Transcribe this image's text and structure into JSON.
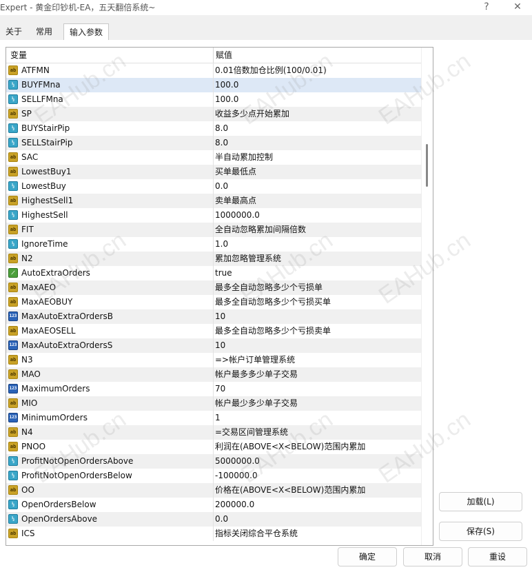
{
  "window": {
    "title": "Expert - 黄金印钞机-EA，五天翻倍系统~",
    "help_label": "?",
    "close_label": "✕"
  },
  "tabs": [
    {
      "label": "关于"
    },
    {
      "label": "常用"
    },
    {
      "label": "输入参数"
    }
  ],
  "table": {
    "header_variable": "变量",
    "header_value": "赋值",
    "rows": [
      {
        "type": "ab",
        "name": "ATFMN",
        "value": "0.01倍数加仓比例(100/0.01)"
      },
      {
        "type": "dbl",
        "name": "BUYFMna",
        "value": "100.0"
      },
      {
        "type": "dbl",
        "name": "SELLFMna",
        "value": "100.0"
      },
      {
        "type": "ab",
        "name": "SP",
        "value": "收益多少点开始累加"
      },
      {
        "type": "dbl",
        "name": "BUYStairPip",
        "value": "8.0"
      },
      {
        "type": "dbl",
        "name": "SELLStairPip",
        "value": "8.0"
      },
      {
        "type": "ab",
        "name": "SAC",
        "value": "半自动累加控制"
      },
      {
        "type": "ab",
        "name": "LowestBuy1",
        "value": "买单最低点"
      },
      {
        "type": "dbl",
        "name": "LowestBuy",
        "value": "0.0"
      },
      {
        "type": "ab",
        "name": "HighestSell1",
        "value": "卖单最高点"
      },
      {
        "type": "dbl",
        "name": "HighestSell",
        "value": "1000000.0"
      },
      {
        "type": "ab",
        "name": "FIT",
        "value": "全自动忽略累加间隔倍数"
      },
      {
        "type": "dbl",
        "name": "IgnoreTime",
        "value": "1.0"
      },
      {
        "type": "ab",
        "name": "N2",
        "value": "累加忽略管理系统"
      },
      {
        "type": "bool",
        "name": "AutoExtraOrders",
        "value": "true"
      },
      {
        "type": "ab",
        "name": "MaxAEO",
        "value": "最多全自动忽略多少个亏损单"
      },
      {
        "type": "ab",
        "name": "MaxAEOBUY",
        "value": "最多全自动忽略多少个亏损买单"
      },
      {
        "type": "int",
        "name": "MaxAutoExtraOrdersB",
        "value": "10"
      },
      {
        "type": "ab",
        "name": "MaxAEOSELL",
        "value": "最多全自动忽略多少个亏损卖单"
      },
      {
        "type": "int",
        "name": "MaxAutoExtraOrdersS",
        "value": "10"
      },
      {
        "type": "ab",
        "name": "N3",
        "value": "=>帐户订单管理系统"
      },
      {
        "type": "ab",
        "name": "MAO",
        "value": "帐户最多多少单子交易"
      },
      {
        "type": "int",
        "name": "MaximumOrders",
        "value": "70"
      },
      {
        "type": "ab",
        "name": "MIO",
        "value": "帐户最少多少单子交易"
      },
      {
        "type": "int",
        "name": "MinimumOrders",
        "value": "1"
      },
      {
        "type": "ab",
        "name": "N4",
        "value": "=交易区间管理系统"
      },
      {
        "type": "ab",
        "name": "PNOO",
        "value": "利润在(ABOVE<X<BELOW)范围内累加"
      },
      {
        "type": "dbl",
        "name": "ProfitNotOpenOrdersAbove",
        "value": "5000000.0"
      },
      {
        "type": "dbl",
        "name": "ProfitNotOpenOrdersBelow",
        "value": "-100000.0"
      },
      {
        "type": "ab",
        "name": "OO",
        "value": "价格在(ABOVE<X<BELOW)范围内累加"
      },
      {
        "type": "dbl",
        "name": "OpenOrdersBelow",
        "value": "200000.0"
      },
      {
        "type": "dbl",
        "name": "OpenOrdersAbove",
        "value": "0.0"
      },
      {
        "type": "ab",
        "name": "ICS",
        "value": "指标关闭综合平仓系统"
      }
    ]
  },
  "icon_glyphs": {
    "ab": "ab",
    "dbl": "½",
    "int": "123",
    "bool": "⟋"
  },
  "buttons": {
    "load": "加载(L)",
    "save": "保存(S)",
    "ok": "确定",
    "cancel": "取消",
    "reset": "重设"
  },
  "watermark": "EAHub.cn"
}
